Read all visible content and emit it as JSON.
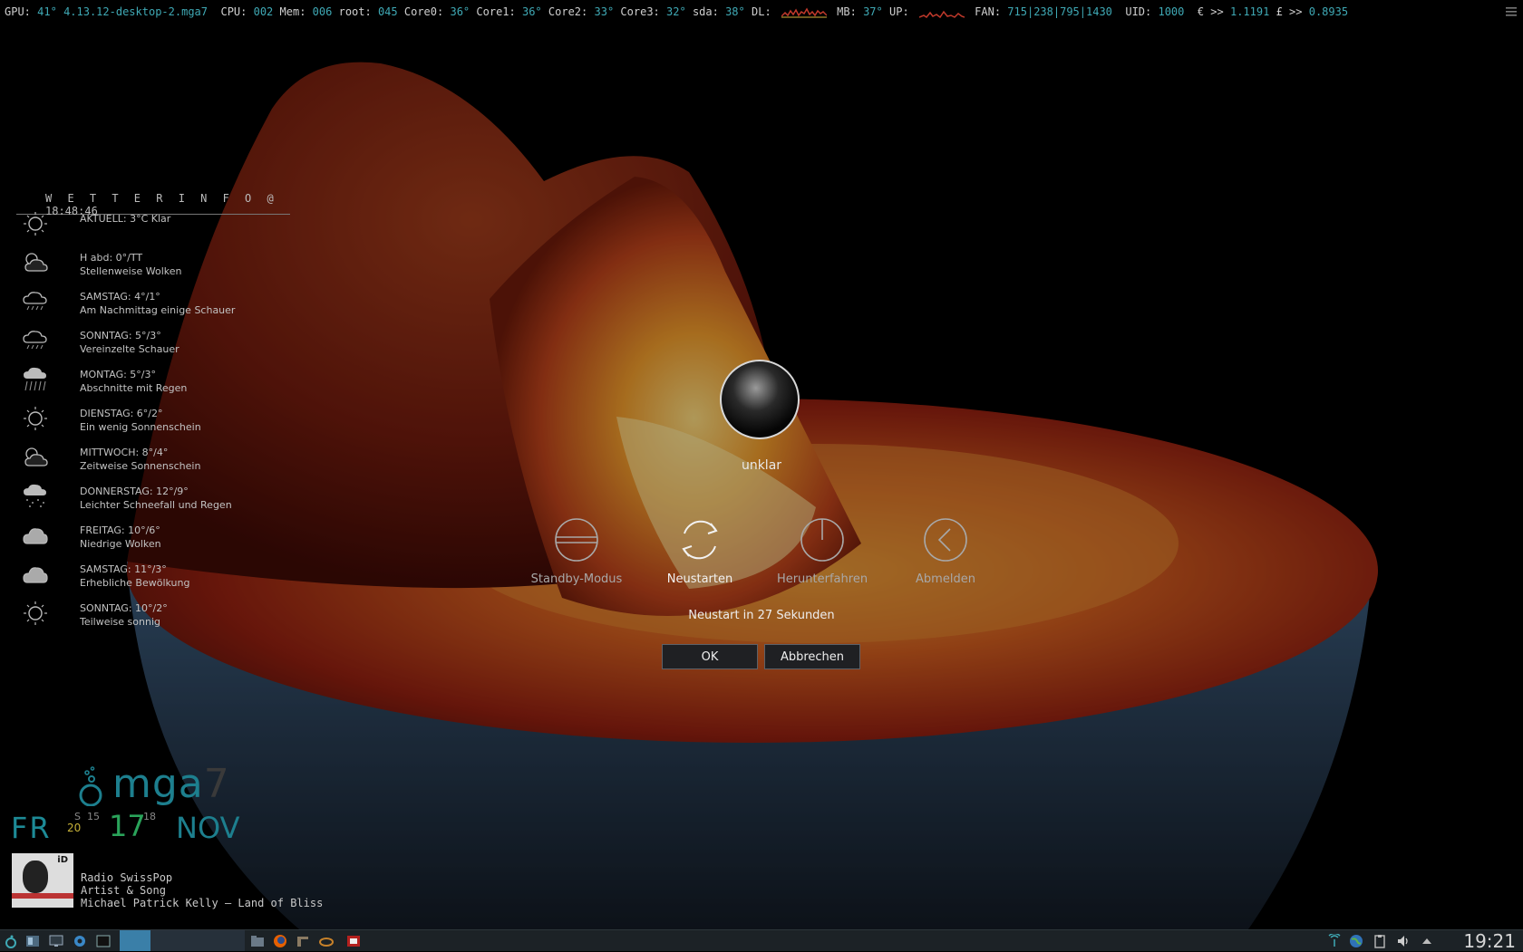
{
  "conky": {
    "gpu_label": "GPU:",
    "gpu_temp": "41°",
    "kernel": "4.13.12-desktop-2.mga7",
    "cpu_label": "CPU:",
    "cpu": "002",
    "mem_label": "Mem:",
    "mem": "006",
    "root_label": "root:",
    "root": "045",
    "core0_label": "Core0:",
    "core0": "36°",
    "core1_label": "Core1:",
    "core1": "36°",
    "core2_label": "Core2:",
    "core2": "33°",
    "core3_label": "Core3:",
    "core3": "32°",
    "sda_label": "sda:",
    "sda": "38°",
    "dl_label": "DL:",
    "mb_label": "MB:",
    "mb": "37°",
    "up_label": "UP:",
    "fan_label": "FAN:",
    "fan": "715|238|795|1430",
    "uid_label": "UID:",
    "uid": "1000",
    "eur_label": "€ >>",
    "eur": "1.1191",
    "gbp_label": "£ >>",
    "gbp": "0.8935"
  },
  "weather": {
    "title": "W E T T E R   I N F O",
    "time": "@ 18:48:46",
    "rows": [
      {
        "icon": "sun-icon",
        "line1": "AKTUELL: 3°C  Klar",
        "line2": ""
      },
      {
        "icon": "partly-cloudy-icon",
        "line1": "H abd: 0°/TT",
        "line2": "Stellenweise Wolken"
      },
      {
        "icon": "showers-icon",
        "line1": "SAMSTAG: 4°/1°",
        "line2": "Am Nachmittag einige Schauer"
      },
      {
        "icon": "showers-icon",
        "line1": "SONNTAG: 5°/3°",
        "line2": "Vereinzelte Schauer"
      },
      {
        "icon": "rain-icon",
        "line1": "MONTAG: 5°/3°",
        "line2": "Abschnitte mit Regen"
      },
      {
        "icon": "sun-icon",
        "line1": "DIENSTAG: 6°/2°",
        "line2": "Ein wenig Sonnenschein"
      },
      {
        "icon": "partly-cloudy-icon",
        "line1": "MITTWOCH: 8°/4°",
        "line2": "Zeitweise Sonnenschein"
      },
      {
        "icon": "snow-rain-icon",
        "line1": "DONNERSTAG: 12°/9°",
        "line2": "Leichter Schneefall und Regen"
      },
      {
        "icon": "cloud-icon",
        "line1": "FREITAG: 10°/6°",
        "line2": "Niedrige Wolken"
      },
      {
        "icon": "cloud-icon",
        "line1": "SAMSTAG: 11°/3°",
        "line2": "Erhebliche Bewölkung"
      },
      {
        "icon": "sun-icon",
        "line1": "SONNTAG: 10°/2°",
        "line2": "Teilweise sonnig"
      }
    ]
  },
  "dialog": {
    "user": "unklar",
    "actions": [
      {
        "label": "Standby-Modus",
        "icon": "standby-icon",
        "active": false
      },
      {
        "label": "Neustarten",
        "icon": "restart-icon",
        "active": true
      },
      {
        "label": "Herunterfahren",
        "icon": "power-icon",
        "active": false
      },
      {
        "label": "Abmelden",
        "icon": "logout-icon",
        "active": false
      }
    ],
    "countdown": "Neustart in 27 Sekunden",
    "ok_label": "OK",
    "cancel_label": "Abbrechen"
  },
  "desktop": {
    "logo_text": "mga",
    "logo_version": "7",
    "day": "FR",
    "date_small_a": "S",
    "date_small_b": "15",
    "date_small_c": "20",
    "date_num": "17",
    "date_small_d": "18",
    "month": "NOV",
    "radio_tag": "iD",
    "radio_station": "Radio SwissPop",
    "radio_line2": "Artist & Song",
    "radio_track": "Michael Patrick Kelly — Land of Bliss"
  },
  "taskbar": {
    "clock": "19:21"
  },
  "colors": {
    "accent": "#3fa9b5",
    "taskbar": "#1c2226",
    "logo": "#1d7f8e"
  }
}
